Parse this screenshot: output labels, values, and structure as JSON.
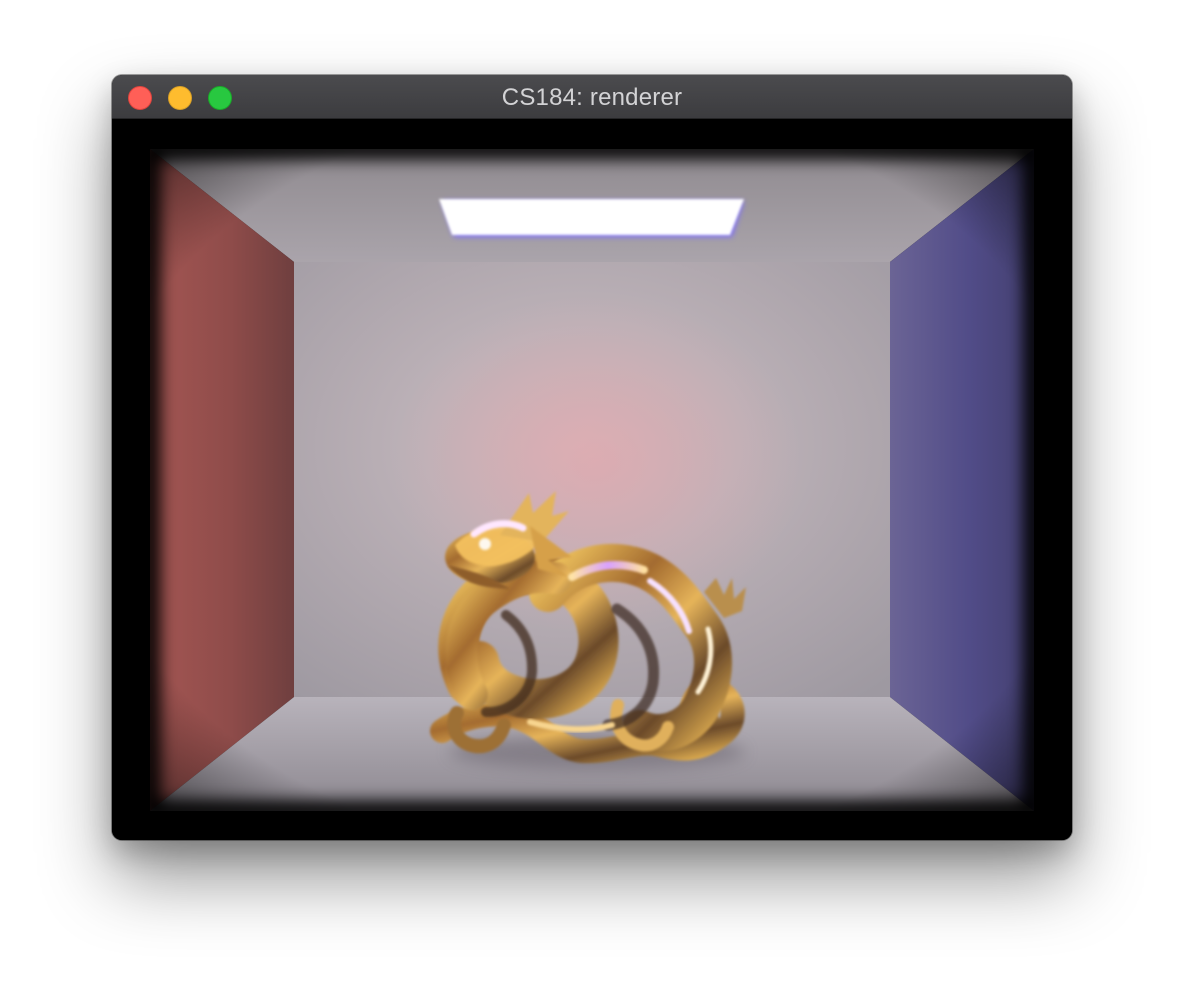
{
  "window": {
    "title": "CS184: renderer",
    "controls": {
      "close_icon": "close-icon",
      "minimize_icon": "minimize-icon",
      "maximize_icon": "maximize-icon"
    }
  },
  "colors": {
    "close": "#ff5f57",
    "minimize": "#febc2e",
    "maximize": "#28c840",
    "left_wall": "#93504d",
    "right_wall": "#4d4a84",
    "back_wall": "#b4afb4",
    "floor": "#aca7b0",
    "ceiling": "#918c92",
    "area_light": "#ffffff",
    "dragon_gold": "#c89a43"
  }
}
